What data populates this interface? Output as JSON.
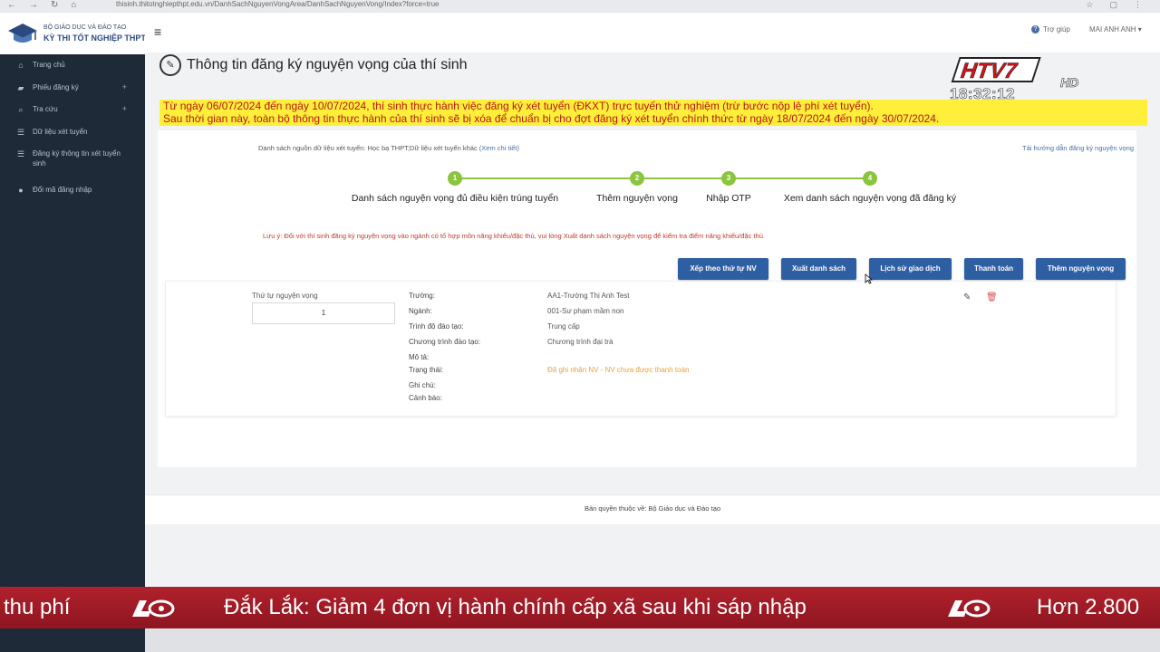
{
  "browser": {
    "nav": [
      "←",
      "→",
      "↻",
      "⌂"
    ],
    "url": "thisinh.thitotnghiepthpt.edu.vn/DanhSachNguyenVongArea/DanhSachNguyenVong/Index?force=true",
    "right_icons": [
      "☆",
      "▢",
      "⋮"
    ]
  },
  "logo": {
    "line1": "BỘ GIÁO DỤC VÀ ĐÀO TẠO",
    "line2": "KỲ THI TỐT NGHIỆP THPT"
  },
  "sidebar": {
    "items": [
      {
        "icon": "home-icon",
        "glyph": "⌂",
        "label": "Trang chủ",
        "plus": ""
      },
      {
        "icon": "folder-icon",
        "glyph": "▰",
        "label": "Phiếu đăng ký",
        "plus": "+"
      },
      {
        "icon": "search-icon",
        "glyph": "⌕",
        "label": "Tra cứu",
        "plus": "+"
      },
      {
        "icon": "list-icon",
        "glyph": "☰",
        "label": "Dữ liệu xét tuyển",
        "plus": ""
      },
      {
        "icon": "list-icon",
        "glyph": "☰",
        "label": "Đăng ký thông tin xét tuyển sinh",
        "plus": ""
      },
      {
        "icon": "user-icon",
        "glyph": "●",
        "label": "Đổi mã đăng nhập",
        "plus": ""
      }
    ]
  },
  "topbar": {
    "hamburger": "≡",
    "help_glyph": "?",
    "help": "Trợ giúp",
    "user": "MAI ANH ANH ▾"
  },
  "page": {
    "title_icon": "✎",
    "title": "Thông tin đăng ký nguyện vọng của thí sinh"
  },
  "alert": {
    "line1": "Từ ngày 06/07/2024 đến ngày 10/07/2024, thí sinh thực hành việc đăng ký xét tuyển (ĐKXT) trực tuyến thử nghiệm (trừ bước nộp lệ phí xét tuyển).",
    "line2": "Sau thời gian này, toàn bộ thông tin thực hành của thí sinh sẽ bị xóa để chuẩn bị cho đợt đăng ký xét tuyển chính thức từ ngày 18/07/2024 đến ngày 30/07/2024."
  },
  "card": {
    "sources": "Danh sách nguồn dữ liệu xét tuyển: Học bạ THPT;Dữ liệu xét tuyển khác",
    "sources_link": "(Xem chi tiết)",
    "guide_link": "Tải hướng dẫn đăng ký nguyện vọng",
    "steps": [
      {
        "num": "1",
        "label": "Danh sách nguyện vọng đủ điều kiện trúng tuyển"
      },
      {
        "num": "2",
        "label": "Thêm nguyện vọng"
      },
      {
        "num": "3",
        "label": "Nhập OTP"
      },
      {
        "num": "4",
        "label": "Xem danh sách nguyện vọng đã đăng ký"
      }
    ],
    "note": "Lưu ý: Đối với thí sinh đăng ký nguyện vọng vào ngành có tổ hợp môn năng khiếu/đặc thù, vui lòng Xuất danh sách nguyện vọng để kiểm tra điểm năng khiếu/đặc thù.",
    "buttons": {
      "sort": "Xếp theo thứ tự NV",
      "export": "Xuất danh sách",
      "history": "Lịch sử giao dịch",
      "pay": "Thanh toán",
      "add": "Thêm nguyện vọng"
    }
  },
  "entry": {
    "order_label": "Thứ tự nguyện vọng",
    "order_value": "1",
    "edit_glyph": "✎",
    "delete_glyph": "🗑",
    "fields": [
      {
        "label": "Trường:",
        "value": "AA1-Trường Thị Anh Test"
      },
      {
        "label": "Ngành:",
        "value": "001-Sư phạm mầm non"
      },
      {
        "label": "Trình độ đào tạo:",
        "value": "Trung cấp"
      },
      {
        "label": "Chương trình đào tạo:",
        "value": "Chương trình đại trà"
      },
      {
        "label": "Mô tả:",
        "value": ""
      },
      {
        "label": "Trạng thái:",
        "value": "Đã ghi nhận NV - NV chưa được thanh toán"
      },
      {
        "label": "Ghi chú:",
        "value": ""
      },
      {
        "label": "Cảnh báo:",
        "value": ""
      }
    ]
  },
  "footer": {
    "text": "Bản quyền thuộc về: Bộ Giáo dục và Đào tạo"
  },
  "broadcast": {
    "channel": "HTV7",
    "channel_sub": "HD",
    "time": "18:32:12",
    "ticker_left": "thu phí",
    "ticker_main": "Đắk Lắk: Giảm 4 đơn vị hành chính cấp xã sau khi sáp nhập",
    "ticker_right": "Hơn 2.800"
  },
  "colors": {
    "sidebar_bg": "#1f2a38",
    "button_blue": "#2e5fa3",
    "step_green": "#8bc53f",
    "alert_yellow": "#ffef3a",
    "alert_text": "#b4161b",
    "status_orange": "#e8a13a",
    "ticker_red": "#a51c26"
  }
}
